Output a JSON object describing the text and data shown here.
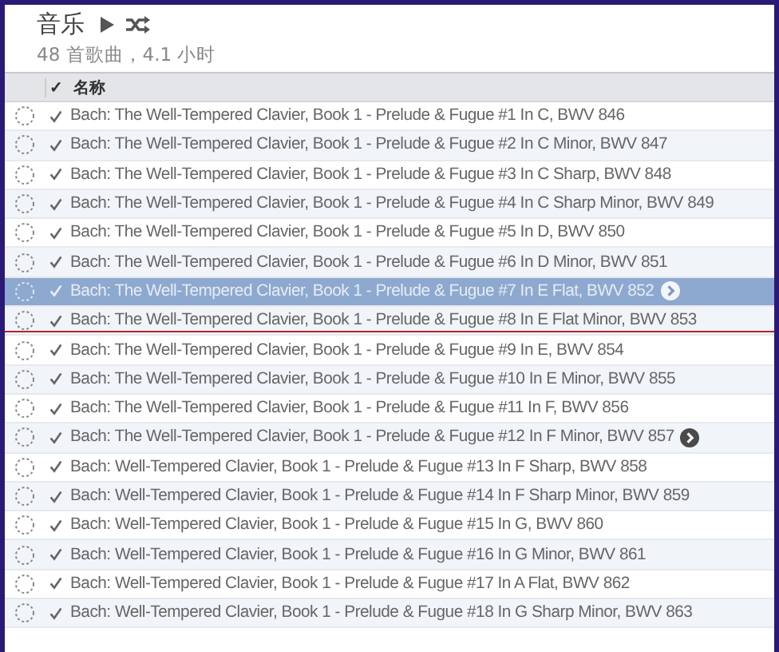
{
  "header": {
    "title": "音乐",
    "subtitle": "48 首歌曲，4.1 小时"
  },
  "columns": {
    "check": "✓",
    "name": "名称"
  },
  "songs": [
    {
      "title": "Bach: The Well-Tempered Clavier, Book 1 - Prelude & Fugue #1 In C, BWV 846",
      "checked": true,
      "selected": false,
      "arrow": false
    },
    {
      "title": "Bach: The Well-Tempered Clavier, Book 1 - Prelude & Fugue #2 In C Minor, BWV 847",
      "checked": true,
      "selected": false,
      "arrow": false
    },
    {
      "title": "Bach: The Well-Tempered Clavier, Book 1 - Prelude & Fugue #3 In C Sharp, BWV 848",
      "checked": true,
      "selected": false,
      "arrow": false
    },
    {
      "title": "Bach: The Well-Tempered Clavier, Book 1 - Prelude & Fugue #4 In C Sharp Minor, BWV 849",
      "checked": true,
      "selected": false,
      "arrow": false
    },
    {
      "title": "Bach: The Well-Tempered Clavier, Book 1 - Prelude & Fugue #5 In D, BWV 850",
      "checked": true,
      "selected": false,
      "arrow": false
    },
    {
      "title": "Bach: The Well-Tempered Clavier, Book 1 - Prelude & Fugue #6 In D Minor, BWV 851",
      "checked": true,
      "selected": false,
      "arrow": false
    },
    {
      "title": "Bach: The Well-Tempered Clavier, Book 1 - Prelude & Fugue #7 In E Flat, BWV 852",
      "checked": true,
      "selected": true,
      "arrow": true
    },
    {
      "title": "Bach: The Well-Tempered Clavier, Book 1 - Prelude & Fugue #8 In E Flat Minor, BWV 853",
      "checked": true,
      "selected": false,
      "arrow": false
    },
    {
      "title": "Bach: The Well-Tempered Clavier, Book 1 - Prelude & Fugue #9 In E, BWV 854",
      "checked": true,
      "selected": false,
      "arrow": false
    },
    {
      "title": "Bach: The Well-Tempered Clavier, Book 1 - Prelude & Fugue #10 In E Minor, BWV 855",
      "checked": true,
      "selected": false,
      "arrow": false
    },
    {
      "title": "Bach: The Well-Tempered Clavier, Book 1 - Prelude & Fugue #11 In F, BWV 856",
      "checked": true,
      "selected": false,
      "arrow": false
    },
    {
      "title": "Bach: The Well-Tempered Clavier, Book 1 - Prelude & Fugue #12 In F Minor, BWV 857",
      "checked": true,
      "selected": false,
      "arrow": true
    },
    {
      "title": "Bach: Well-Tempered Clavier, Book 1 - Prelude & Fugue #13 In F Sharp, BWV 858",
      "checked": true,
      "selected": false,
      "arrow": false
    },
    {
      "title": "Bach: Well-Tempered Clavier, Book 1 - Prelude & Fugue #14 In F Sharp Minor, BWV 859",
      "checked": true,
      "selected": false,
      "arrow": false
    },
    {
      "title": "Bach: Well-Tempered Clavier, Book 1 - Prelude & Fugue #15 In G, BWV 860",
      "checked": true,
      "selected": false,
      "arrow": false
    },
    {
      "title": "Bach: Well-Tempered Clavier, Book 1 - Prelude & Fugue #16 In G Minor, BWV 861",
      "checked": true,
      "selected": false,
      "arrow": false
    },
    {
      "title": "Bach: Well-Tempered Clavier, Book 1 - Prelude & Fugue #17 In A Flat, BWV 862",
      "checked": true,
      "selected": false,
      "arrow": false
    },
    {
      "title": "Bach: Well-Tempered Clavier, Book 1 - Prelude & Fugue #18 In G Sharp Minor, BWV 863",
      "checked": true,
      "selected": false,
      "arrow": false
    }
  ]
}
